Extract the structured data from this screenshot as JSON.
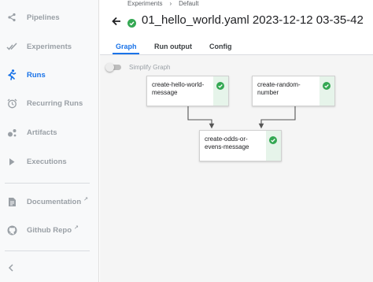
{
  "sidebar": {
    "items": [
      {
        "label": "Pipelines",
        "icon": "pipelines-icon"
      },
      {
        "label": "Experiments",
        "icon": "experiments-icon"
      },
      {
        "label": "Runs",
        "icon": "runs-icon",
        "active": true
      },
      {
        "label": "Recurring Runs",
        "icon": "alarm-icon"
      },
      {
        "label": "Artifacts",
        "icon": "artifacts-icon"
      },
      {
        "label": "Executions",
        "icon": "play-icon"
      }
    ],
    "links": [
      {
        "label": "Documentation",
        "icon": "document-icon"
      },
      {
        "label": "Github Repo",
        "icon": "github-icon"
      }
    ],
    "collapse_icon": "chevron-left-icon"
  },
  "header": {
    "breadcrumb": [
      "Experiments",
      "Default"
    ],
    "breadcrumb_separator": "›",
    "title": "01_hello_world.yaml 2023-12-12 03-35-42"
  },
  "tabs": [
    "Graph",
    "Run output",
    "Config"
  ],
  "graph": {
    "simplify_label": "Simplify Graph",
    "simplify_on": false,
    "nodes": [
      {
        "label": "create-hello-world-\nmessage",
        "status": "succeeded"
      },
      {
        "label": "create-random-\nnumber",
        "status": "succeeded"
      },
      {
        "label": "create-odds-or-\nevens-message",
        "status": "succeeded"
      }
    ]
  },
  "colors": {
    "accent": "#1a73e8",
    "success": "#34a853",
    "success_bg": "#e6f4ea",
    "nav_text": "#9aa0a6"
  }
}
